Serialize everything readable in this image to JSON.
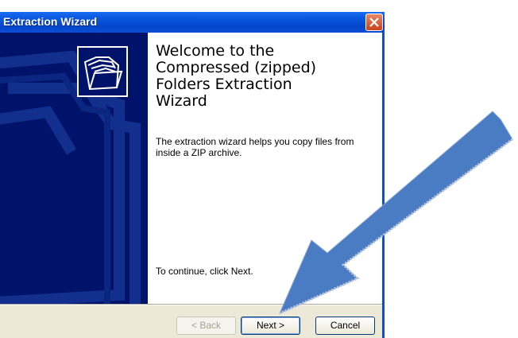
{
  "window": {
    "title": "Extraction Wizard",
    "icons": {
      "close": "close-icon",
      "folder": "zipped-folder-icon"
    }
  },
  "content": {
    "welcome_heading": "Welcome to the\nCompressed (zipped)\nFolders Extraction\nWizard",
    "description": "The extraction wizard helps you copy files from inside a ZIP archive.",
    "continue_text": "To continue, click Next."
  },
  "buttons": {
    "back": "< Back",
    "next": "Next >",
    "cancel": "Cancel"
  },
  "annotation": {
    "arrow_color": "#4a7cc4",
    "points_to": "Next >"
  }
}
